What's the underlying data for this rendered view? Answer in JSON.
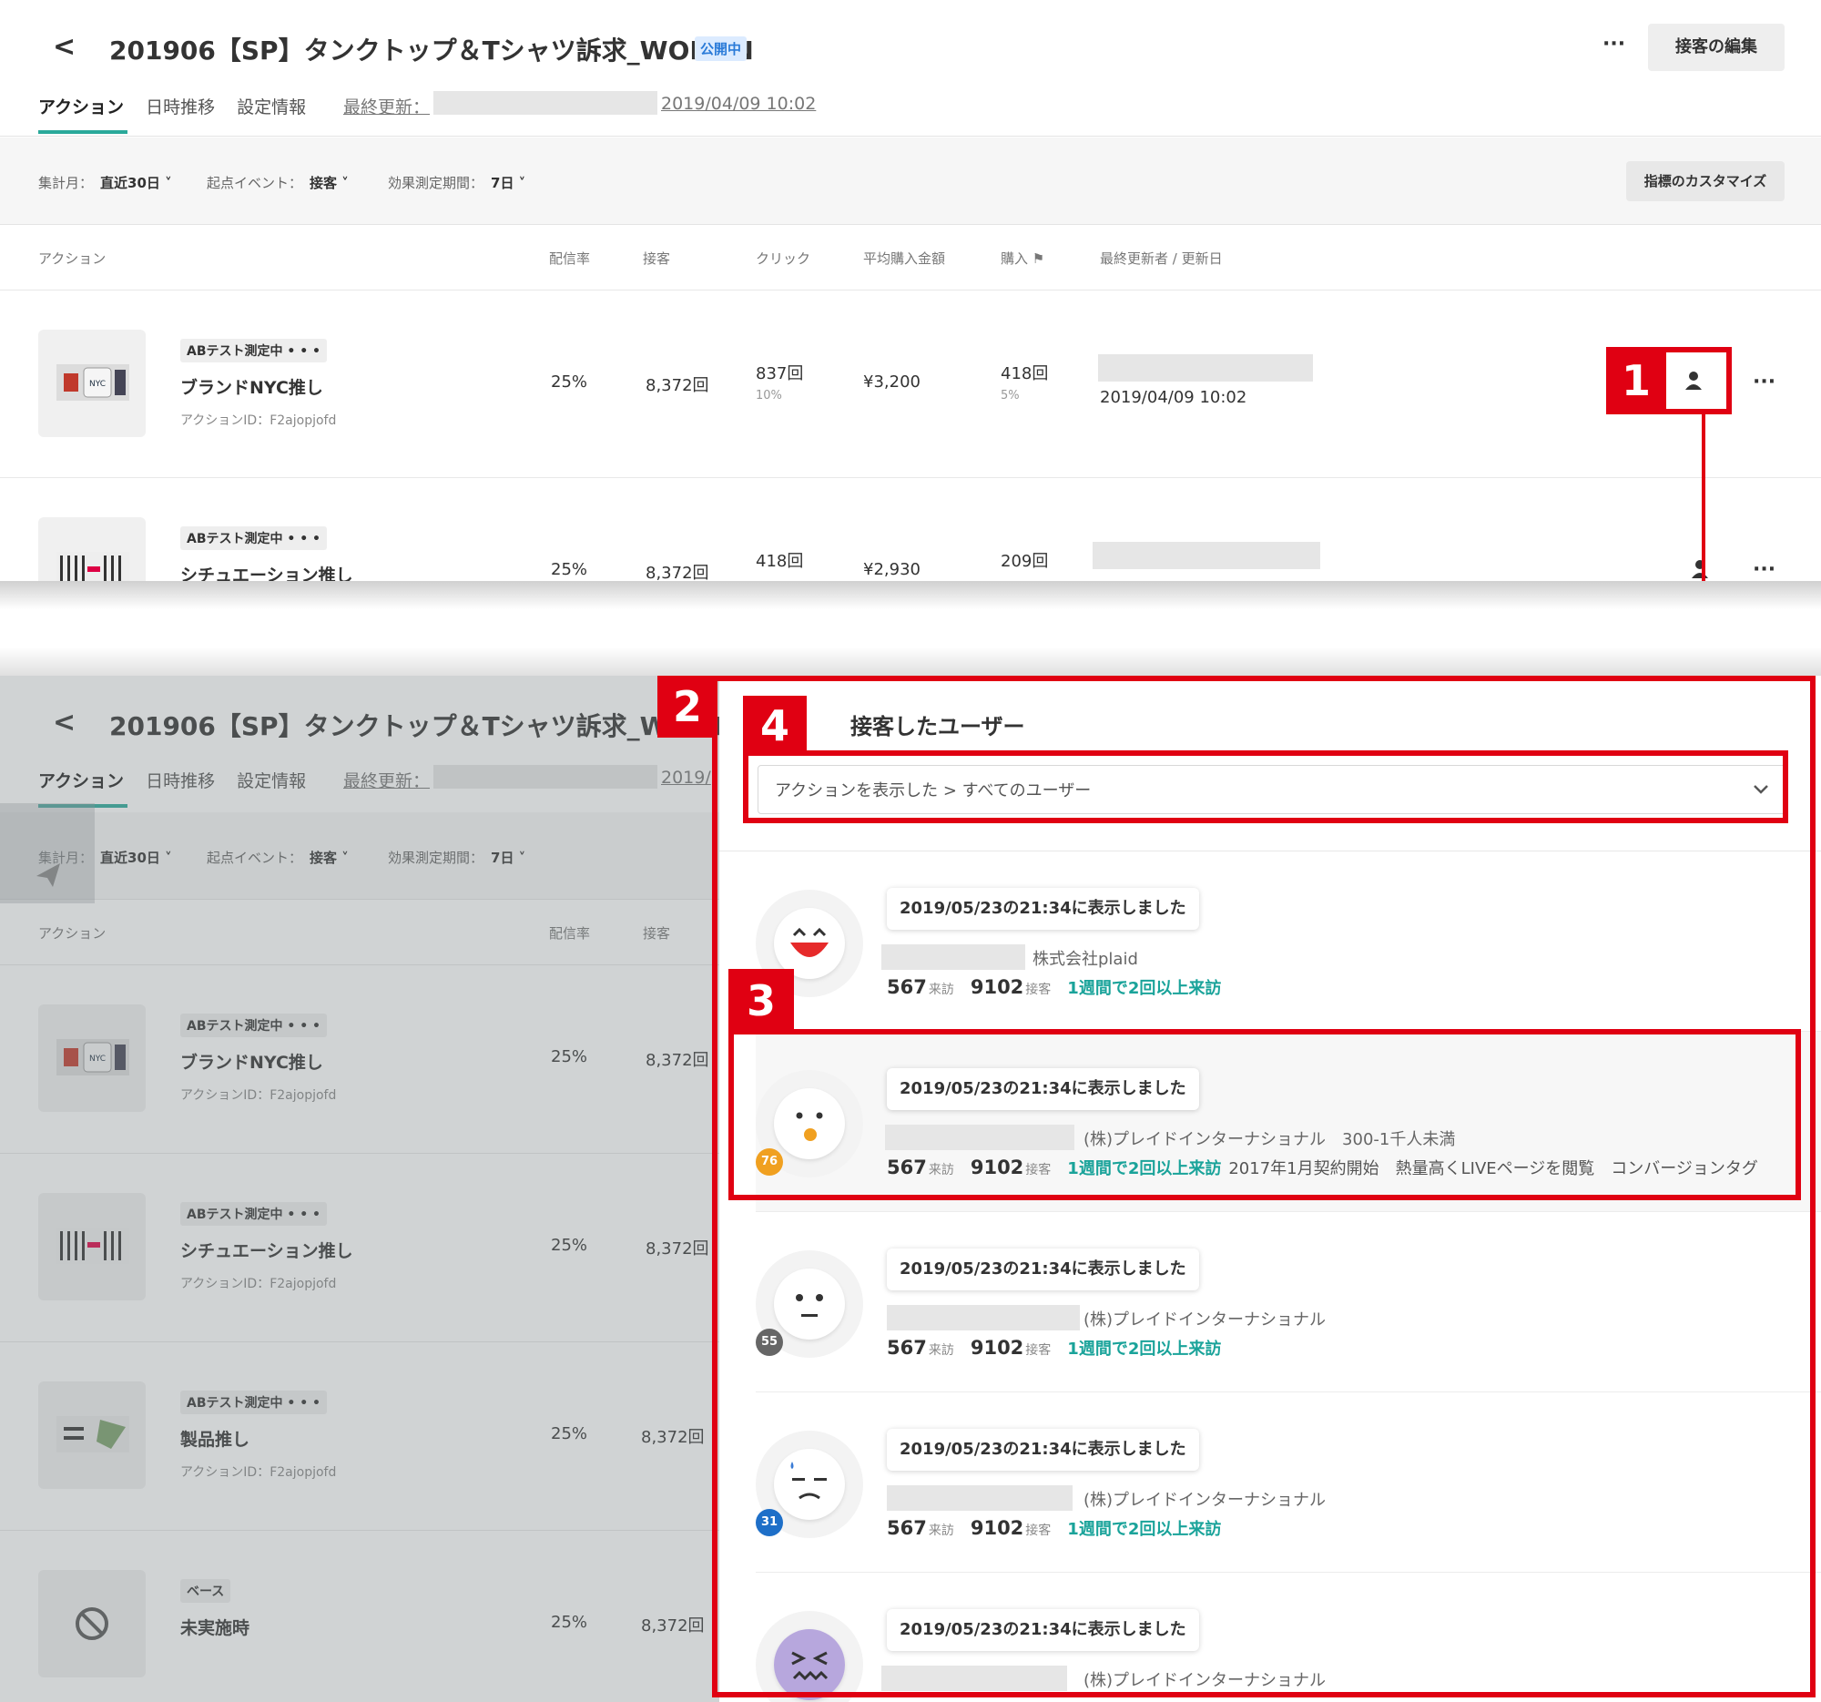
{
  "page": {
    "back_label": "<",
    "title": "201906【SP】タンクトップ＆Tシャツ訴求_WOMEN",
    "title_short": "201906【SP】タンクトップ＆Tシャツ訴求_WOMI",
    "status": "公開中",
    "more": "···",
    "edit_button": "接客の編集",
    "tabs": [
      "アクション",
      "日時推移",
      "設定情報"
    ],
    "updated_label": "最終更新：",
    "updated_date": "2019/04/09 10:02",
    "updated_date_short": "2019/"
  },
  "filters": {
    "period_label": "集計月：",
    "period_value": "直近30日 ˅",
    "event_label": "起点イベント：",
    "event_value": "接客 ˅",
    "effect_label": "効果測定期間：",
    "effect_value": "7日 ˅",
    "customize_button": "指標のカスタマイズ"
  },
  "table": {
    "columns": [
      "アクション",
      "配信率",
      "接客",
      "クリック",
      "平均購入金額",
      "購入 ⚑",
      "最終更新者 / 更新日"
    ],
    "rows": [
      {
        "tag": "ABテスト測定中  • • •",
        "name": "ブランドNYC推し",
        "id": "アクションID：F2ajopjofd",
        "rate": "25%",
        "serve": "8,372回",
        "click": "837回",
        "click_pct": "10%",
        "avg": "¥3,200",
        "buy": "418回",
        "buy_pct": "5%",
        "updated": "2019/04/09 10:02"
      },
      {
        "tag": "ABテスト測定中  • • •",
        "name": "シチュエーション推し",
        "id": "アクションID：F2ajopjofd",
        "rate": "25%",
        "serve": "8,372回",
        "click": "418回",
        "avg": "¥2,930",
        "buy": "209回"
      },
      {
        "tag": "ABテスト測定中  • • •",
        "name": "製品推し",
        "id": "アクションID：F2ajopjofd",
        "rate": "25%",
        "serve": "8,372回"
      },
      {
        "tag": "ベース",
        "name": "未実施時",
        "rate": "25%",
        "serve": "8,372回"
      }
    ]
  },
  "callouts": [
    "1",
    "2",
    "3",
    "4"
  ],
  "drawer": {
    "title": "接客したユーザー",
    "select_value": "アクションを表示した > すべてのユーザー",
    "cards": [
      {
        "shown": "2019/05/23の21:34に表示しました",
        "company": "株式会社plaid",
        "visits": "567",
        "visits_unit": "来訪",
        "serves": "9102",
        "serves_unit": "接客",
        "segment": "1週間で2回以上来訪",
        "extra": ""
      },
      {
        "shown": "2019/05/23の21:34に表示しました",
        "company": "(株)プレイドインターナショナル　300-1千人未満",
        "score": "76",
        "visits": "567",
        "visits_unit": "来訪",
        "serves": "9102",
        "serves_unit": "接客",
        "segment": "1週間で2回以上来訪",
        "extra": "2017年1月契約開始　熱量高くLIVEページを閲覧　コンバージョンタグ"
      },
      {
        "shown": "2019/05/23の21:34に表示しました",
        "company": "(株)プレイドインターナショナル",
        "score": "55",
        "visits": "567",
        "visits_unit": "来訪",
        "serves": "9102",
        "serves_unit": "接客",
        "segment": "1週間で2回以上来訪",
        "extra": ""
      },
      {
        "shown": "2019/05/23の21:34に表示しました",
        "company": "(株)プレイドインターナショナル",
        "score": "31",
        "visits": "567",
        "visits_unit": "来訪",
        "serves": "9102",
        "serves_unit": "接客",
        "segment": "1週間で2回以上来訪",
        "extra": ""
      },
      {
        "shown": "2019/05/23の21:34に表示しました",
        "company": "(株)プレイドインターナショナル"
      }
    ]
  },
  "colors": {
    "accent": "#2aa99a",
    "callout": "#e00012",
    "score_76": "#f0a020",
    "score_55": "#666666",
    "score_31": "#1e6fc8"
  }
}
